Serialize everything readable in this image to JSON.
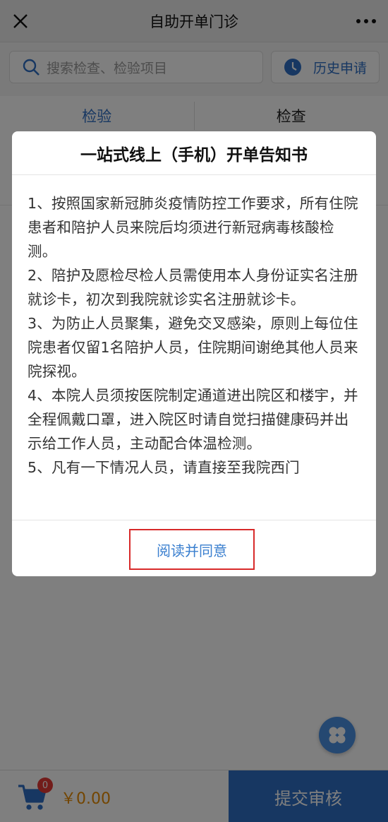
{
  "navbar": {
    "title": "自助开单门诊",
    "close_icon": "close-icon",
    "more_icon": "more-icon"
  },
  "search": {
    "placeholder": "搜索检查、检验项目",
    "history_label": "历史申请"
  },
  "tabs": [
    {
      "label": "检验",
      "active": true
    },
    {
      "label": "检查",
      "active": false
    }
  ],
  "modal": {
    "title": "一站式线上（手机）开单告知书",
    "paragraphs": [
      "1、按照国家新冠肺炎疫情防控工作要求，所有住院患者和陪护人员来院后均须进行新冠病毒核酸检测。",
      "2、陪护及愿检尽检人员需使用本人身份证实名注册就诊卡，初次到我院就诊实名注册就诊卡。",
      "3、为防止人员聚集，避免交叉感染，原则上每位住院患者仅留1名陪护人员，住院期间谢绝其他人员来院探视。",
      "4、本院人员须按医院制定通道进出院区和楼宇，并全程佩戴口罩，进入院区时请自觉扫描健康码并出示给工作人员，主动配合体温检测。",
      "5、凡有一下情况人员，请直接至我院西门"
    ],
    "agree_label": "阅读并同意"
  },
  "bottom": {
    "cart_count": "0",
    "total": "￥0.00",
    "submit_label": "提交审核"
  },
  "colors": {
    "accent": "#2f6fc4",
    "price": "#e68a00",
    "badge": "#e53935",
    "highlight_border": "#d82a2a"
  }
}
